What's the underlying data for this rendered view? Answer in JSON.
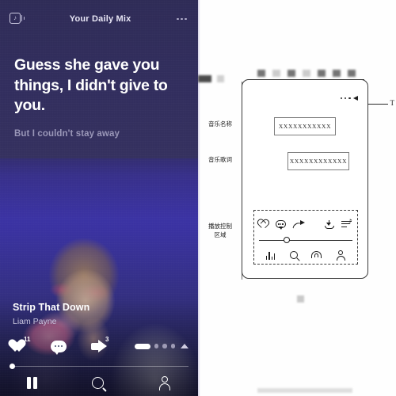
{
  "left_app": {
    "brand_icon": "music-note-speaker-icon",
    "title": "Your Daily Mix",
    "overflow_icon": "more-horizontal-icon",
    "lyric_current": "Guess she gave you things, I didn't give to you.",
    "lyric_next": "But I couldn't stay away",
    "track": {
      "title": "Strip That Down",
      "artist": "Liam Payne"
    },
    "actions": {
      "like_icon": "heart-icon",
      "like_count": "11",
      "comment_icon": "comment-bubble-icon",
      "share_icon": "share-arrow-icon",
      "share_count": "3"
    },
    "pager": {
      "active_icon": "page-pill-active",
      "dot_icon": "page-dot",
      "expand_icon": "triangle-up-icon",
      "dots": 3
    },
    "seek": {
      "progress_percent": 1
    },
    "bottom_nav": [
      {
        "icon": "pause-icon",
        "name": "pause-button"
      },
      {
        "icon": "search-icon",
        "name": "search-button"
      },
      {
        "icon": "profile-icon",
        "name": "profile-button"
      }
    ]
  },
  "right_wireframe": {
    "annotations": {
      "music_name": "音乐名称",
      "music_lyrics": "音乐歌词",
      "playback_control_line1": "播放控制",
      "playback_control_line2": "区域"
    },
    "placeholders": {
      "name_value": "XXXXXXXXXXX",
      "lyric_value": "XXXXXXXXXXXX"
    },
    "tooltip_text": "T",
    "phone_overflow_icon": "more-horizontal-icon",
    "control_icons_top": [
      {
        "icon": "heart-icon",
        "name": "wire-like-icon"
      },
      {
        "icon": "comment-bubble-icon",
        "name": "wire-comment-icon"
      },
      {
        "icon": "share-arrow-icon",
        "name": "wire-share-icon"
      },
      {
        "icon": "download-icon",
        "name": "wire-download-icon"
      },
      {
        "icon": "playlist-music-icon",
        "name": "wire-playlist-icon"
      }
    ],
    "control_icons_bottom": [
      {
        "icon": "equalizer-icon",
        "name": "wire-equalizer-icon"
      },
      {
        "icon": "search-icon",
        "name": "wire-search-icon"
      },
      {
        "icon": "radio-icon",
        "name": "wire-radio-icon"
      },
      {
        "icon": "profile-icon",
        "name": "wire-profile-icon"
      }
    ],
    "slider_position_percent": 26
  },
  "colors": {
    "app_bg": "#2e2b55",
    "accent_white": "#ffffff",
    "muted_text": "#9a97b8",
    "wire_stroke": "#1d1d1d",
    "wire_bg": "#fefefe"
  }
}
